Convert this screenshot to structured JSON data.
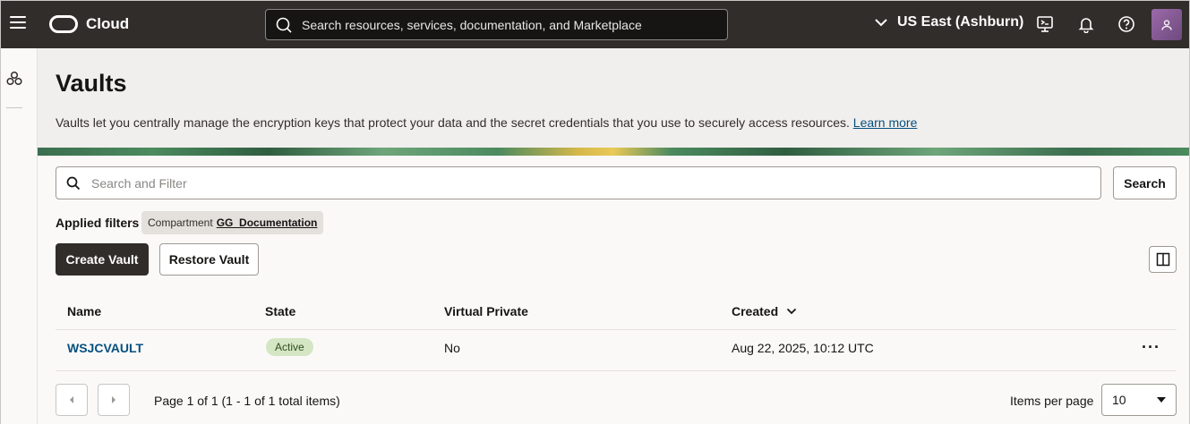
{
  "topbar": {
    "brand": "Cloud",
    "search_placeholder": "Search resources, services, documentation, and Marketplace",
    "region": "US East (Ashburn)"
  },
  "header": {
    "title": "Vaults",
    "description": "Vaults let you centrally manage the encryption keys that protect your data and the secret credentials that you use to securely access resources.",
    "learn_more": "Learn more"
  },
  "filters": {
    "search_placeholder": "Search and Filter",
    "search_button": "Search",
    "applied_label": "Applied filters",
    "chip_key": "Compartment",
    "chip_value": "GG_Documentation"
  },
  "actions": {
    "create": "Create Vault",
    "restore": "Restore Vault"
  },
  "table": {
    "columns": [
      "Name",
      "State",
      "Virtual Private",
      "Created"
    ],
    "rows": [
      {
        "name": "WSJCVAULT",
        "state": "Active",
        "virtual_private": "No",
        "created": "Aug 22, 2025, 10:12 UTC"
      }
    ]
  },
  "pagination": {
    "info": "Page 1 of 1 (1 - 1 of 1 total items)",
    "items_per_page_label": "Items per page",
    "items_per_page_value": "10"
  },
  "colors": {
    "topbar": "#312d2a",
    "link": "#06507f",
    "active_badge": "#d4e6c4"
  }
}
